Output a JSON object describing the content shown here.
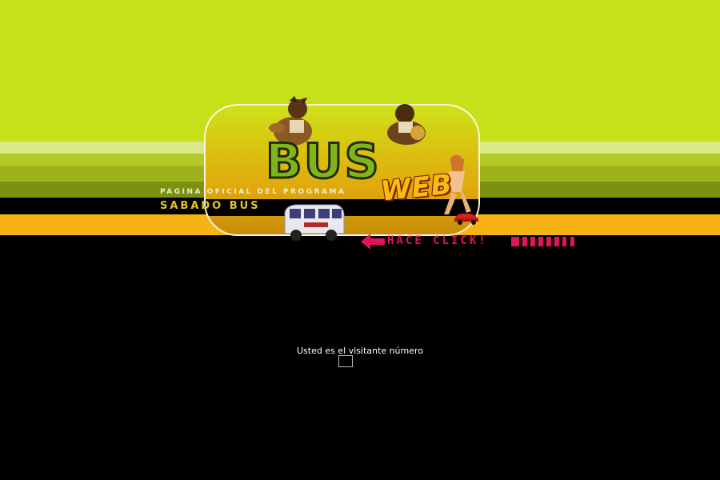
{
  "banner": {
    "logo_main": "BUS",
    "logo_sub": "WEB",
    "tagline": "PAGINA OFICIAL DEL PROGRAMA",
    "program_name": "SABADO BUS",
    "click_prompt": "HACE CLICK!"
  },
  "visitor": {
    "label": "Usted es el visitante número"
  },
  "colors": {
    "lime": "#c6e019",
    "orange": "#f5b414",
    "magenta": "#e0145a",
    "background": "#000000"
  },
  "icons": [
    "left-arrow-icon",
    "bus-icon",
    "car-icon"
  ]
}
